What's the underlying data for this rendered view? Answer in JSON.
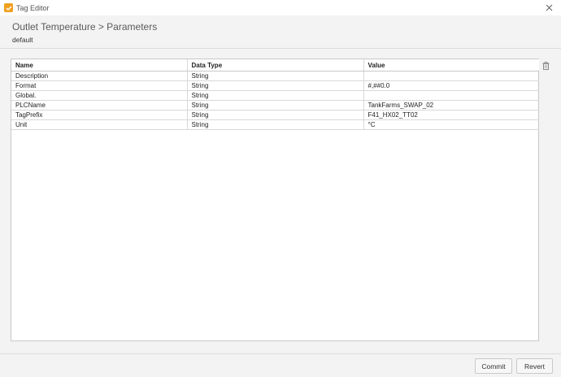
{
  "window": {
    "title": "Tag Editor"
  },
  "header": {
    "breadcrumb": "Outlet Temperature > Parameters",
    "provider": "default"
  },
  "table": {
    "columns": [
      "Name",
      "Data Type",
      "Value"
    ],
    "rows": [
      {
        "name": "Description",
        "type": "String",
        "value": ""
      },
      {
        "name": "Format",
        "type": "String",
        "value": "#,##0.0"
      },
      {
        "name": "Global.",
        "type": "String",
        "value": ""
      },
      {
        "name": "PLCName",
        "type": "String",
        "value": "TankFarms_SWAP_02"
      },
      {
        "name": "TagPrefix",
        "type": "String",
        "value": "F41_HX02_TT02"
      },
      {
        "name": "Unit",
        "type": "String",
        "value": "°C"
      }
    ]
  },
  "footer": {
    "commit_label": "Commit",
    "revert_label": "Revert"
  },
  "icons": {
    "app": "tag-editor-icon",
    "close": "close-icon",
    "delete": "trash-icon"
  },
  "colors": {
    "app_icon": "#f0a020"
  }
}
